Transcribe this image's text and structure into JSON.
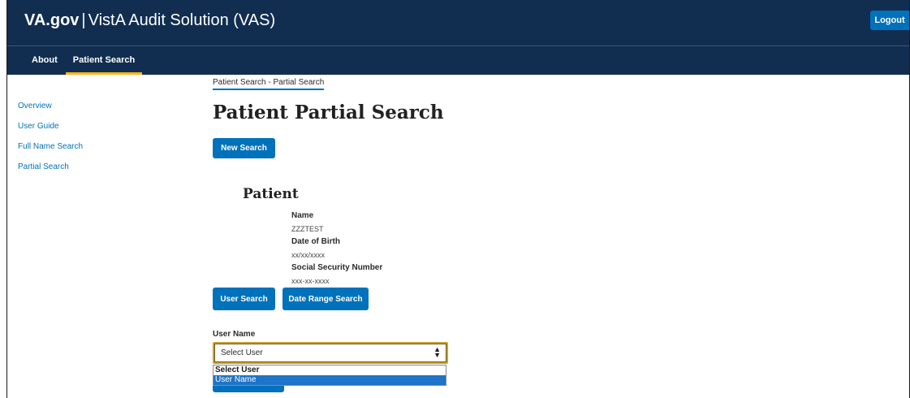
{
  "header": {
    "logo": "VA.gov",
    "separator": "|",
    "app_title": "VistA Audit Solution (VAS)",
    "logout_label": "Logout"
  },
  "nav": {
    "items": [
      {
        "label": "About"
      },
      {
        "label": "Patient Search"
      }
    ],
    "active": "Patient Search"
  },
  "sidebar": {
    "items": [
      {
        "label": "Overview"
      },
      {
        "label": "User Guide"
      },
      {
        "label": "Full Name Search"
      },
      {
        "label": "Partial Search"
      }
    ]
  },
  "main": {
    "breadcrumb": "Patient Search - Partial Search",
    "title": "Patient Partial Search",
    "new_search_label": "New Search",
    "patient": {
      "heading": "Patient",
      "fields": [
        {
          "label": "Name",
          "value": "ZZZTEST"
        },
        {
          "label": "Date of Birth",
          "value": "xx/xx/xxxx"
        },
        {
          "label": "Social Security Number",
          "value": "xxx-xx-xxxx"
        }
      ]
    },
    "search_buttons": {
      "user_search": "User Search",
      "date_range_search": "Date Range Search"
    },
    "user_select": {
      "label": "User Name",
      "selected": "Select User",
      "options": [
        "Select User",
        "User Name"
      ],
      "highlighted": "User Name"
    }
  },
  "colors": {
    "header_bg": "#112e51",
    "primary_button": "#0071bb",
    "nav_active_underline": "#fdb81e",
    "link": "#0071bb",
    "focus_outline": "#c9a227",
    "option_highlight": "#1f73c8"
  }
}
